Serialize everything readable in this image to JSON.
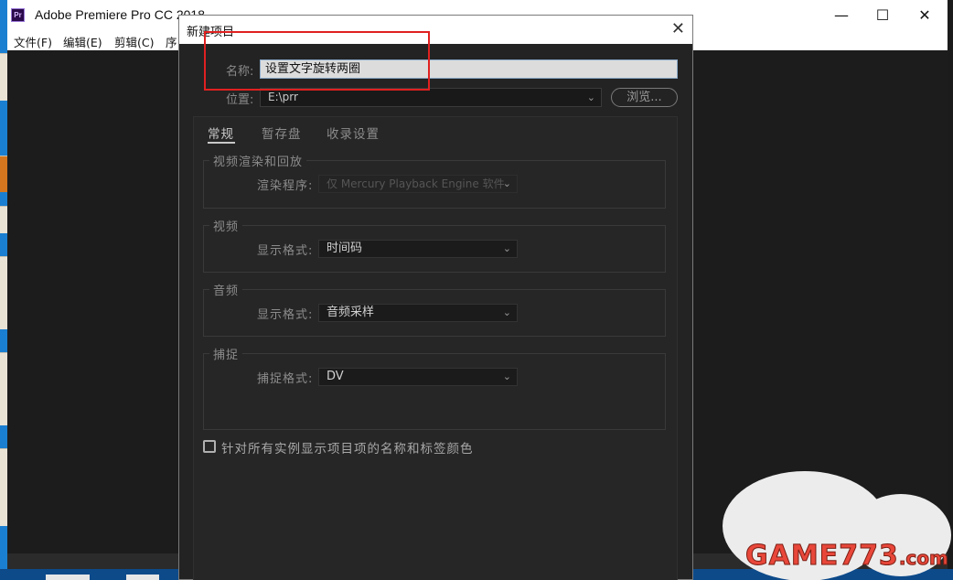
{
  "app": {
    "logo": "Pr",
    "title": "Adobe Premiere Pro CC 2018",
    "window_controls": {
      "minimize": "—",
      "maximize": "☐",
      "close": "✕"
    },
    "menu": [
      "文件(F)",
      "编辑(E)",
      "剪辑(C)",
      "序"
    ]
  },
  "dialog": {
    "title": "新建项目",
    "close": "✕",
    "name_label": "名称:",
    "name_value": "设置文字旋转两圈",
    "location_label": "位置:",
    "location_value": "E:\\prr",
    "browse_label": "浏览...",
    "tabs": [
      {
        "label": "常规",
        "active": true
      },
      {
        "label": "暂存盘",
        "active": false
      },
      {
        "label": "收录设置",
        "active": false
      }
    ],
    "groups": {
      "render": {
        "title": "视频渲染和回放",
        "field_label": "渲染程序:",
        "value": "仅 Mercury Playback Engine 软件"
      },
      "video": {
        "title": "视频",
        "field_label": "显示格式:",
        "value": "时间码"
      },
      "audio": {
        "title": "音频",
        "field_label": "显示格式:",
        "value": "音频采样"
      },
      "capture": {
        "title": "捕捉",
        "field_label": "捕捉格式:",
        "value": "DV"
      }
    },
    "checkbox_label": "针对所有实例显示项目项的名称和标签颜色",
    "checkbox_checked": false
  },
  "watermark": {
    "main": "GAME773",
    "suffix": ".com"
  },
  "colors": {
    "highlight_box": "#e02020",
    "accent": "#8aa9c9"
  }
}
